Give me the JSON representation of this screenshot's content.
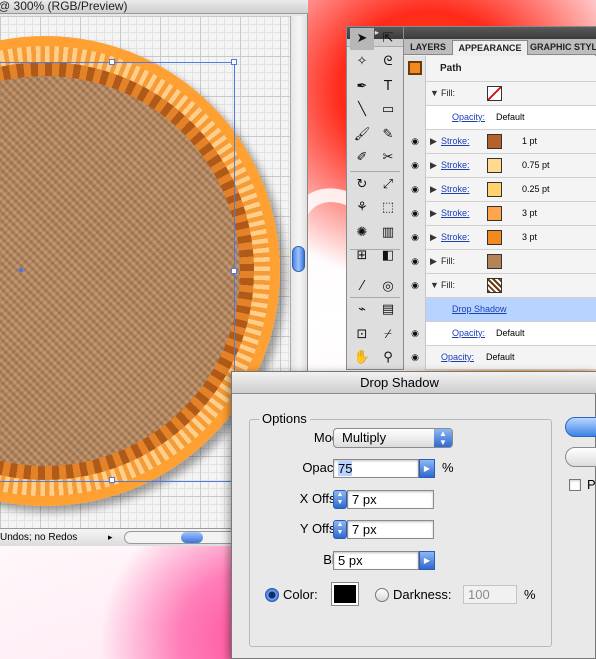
{
  "document": {
    "title": "@ 300% (RGB/Preview)",
    "status_text": "Undos; no Redos"
  },
  "tools": {
    "items": [
      {
        "icon": "selection-arrow-icon",
        "glyph": "➤"
      },
      {
        "icon": "direct-selection-icon",
        "glyph": "⇱"
      },
      {
        "icon": "magic-wand-icon",
        "glyph": "✧"
      },
      {
        "icon": "lasso-icon",
        "glyph": "ᘓ"
      },
      {
        "icon": "pen-icon",
        "glyph": "✒"
      },
      {
        "icon": "type-icon",
        "glyph": "T"
      },
      {
        "icon": "line-icon",
        "glyph": "╲"
      },
      {
        "icon": "rectangle-icon",
        "glyph": "▭"
      },
      {
        "icon": "paintbrush-icon",
        "glyph": "🖌"
      },
      {
        "icon": "pencil-icon",
        "glyph": "✎"
      },
      {
        "icon": "blob-brush-icon",
        "glyph": "✐"
      },
      {
        "icon": "eraser-icon",
        "glyph": "✂"
      },
      {
        "icon": "rotate-icon",
        "glyph": "↻"
      },
      {
        "icon": "scale-icon",
        "glyph": "⤢"
      },
      {
        "icon": "warp-icon",
        "glyph": "⚘"
      },
      {
        "icon": "free-transform-icon",
        "glyph": "⬚"
      },
      {
        "icon": "symbol-sprayer-icon",
        "glyph": "✺"
      },
      {
        "icon": "column-graph-icon",
        "glyph": "▥"
      },
      {
        "icon": "mesh-icon",
        "glyph": "⊞"
      },
      {
        "icon": "gradient-icon",
        "glyph": "◧"
      },
      {
        "icon": "eyedropper-icon",
        "glyph": "⁄"
      },
      {
        "icon": "blend-icon",
        "glyph": "◎"
      },
      {
        "icon": "slice-icon",
        "glyph": "⌁"
      },
      {
        "icon": "graph-icon",
        "glyph": "▤"
      },
      {
        "icon": "artboard-icon",
        "glyph": "⊡"
      },
      {
        "icon": "knife-icon",
        "glyph": "⌿"
      },
      {
        "icon": "hand-icon",
        "glyph": "✋"
      },
      {
        "icon": "zoom-icon",
        "glyph": "⚲"
      }
    ]
  },
  "appearance": {
    "tabs": [
      "LAYERS",
      "APPEARANCE",
      "GRAPHIC STYLES"
    ],
    "active_tab": "APPEARANCE",
    "header": "Path",
    "rows": [
      {
        "kind": "fill",
        "label": "Fill:",
        "swatch": "none",
        "expanded": true
      },
      {
        "kind": "opacity",
        "label": "Opacity:",
        "value": "Default"
      },
      {
        "kind": "stroke",
        "label": "Stroke:",
        "swatch": "#b5622a",
        "value": "1 pt"
      },
      {
        "kind": "stroke",
        "label": "Stroke:",
        "swatch": "#ffd98f",
        "value": "0.75 pt"
      },
      {
        "kind": "stroke",
        "label": "Stroke:",
        "swatch": "#ffd36b",
        "value": "0.25 pt"
      },
      {
        "kind": "stroke",
        "label": "Stroke:",
        "swatch": "#ffa64a",
        "value": "3 pt"
      },
      {
        "kind": "stroke",
        "label": "Stroke:",
        "swatch": "#f28a1e",
        "value": "3 pt"
      },
      {
        "kind": "fill",
        "label": "Fill:",
        "swatch": "#b48458"
      },
      {
        "kind": "fill",
        "label": "Fill:",
        "swatch": "pattern",
        "expanded": true
      },
      {
        "kind": "effect",
        "label": "Drop Shadow"
      },
      {
        "kind": "opacity",
        "label": "Opacity:",
        "value": "Default"
      },
      {
        "kind": "opacity-top",
        "label": "Opacity:",
        "value": "Default"
      }
    ]
  },
  "dialog": {
    "title": "Drop Shadow",
    "options_label": "Options",
    "mode_label": "Mode:",
    "mode_value": "Multiply",
    "opacity_label": "Opacity:",
    "opacity_value": "75",
    "opacity_unit": "%",
    "x_offset_label": "X Offset:",
    "x_offset_value": "7 px",
    "y_offset_label": "Y Offset:",
    "y_offset_value": "7 px",
    "blur_label": "Blur:",
    "blur_value": "5 px",
    "color_label": "Color:",
    "color_value": "#000000",
    "darkness_label": "Darkness:",
    "darkness_value": "100",
    "darkness_unit": "%",
    "preview_label": "Pr"
  }
}
